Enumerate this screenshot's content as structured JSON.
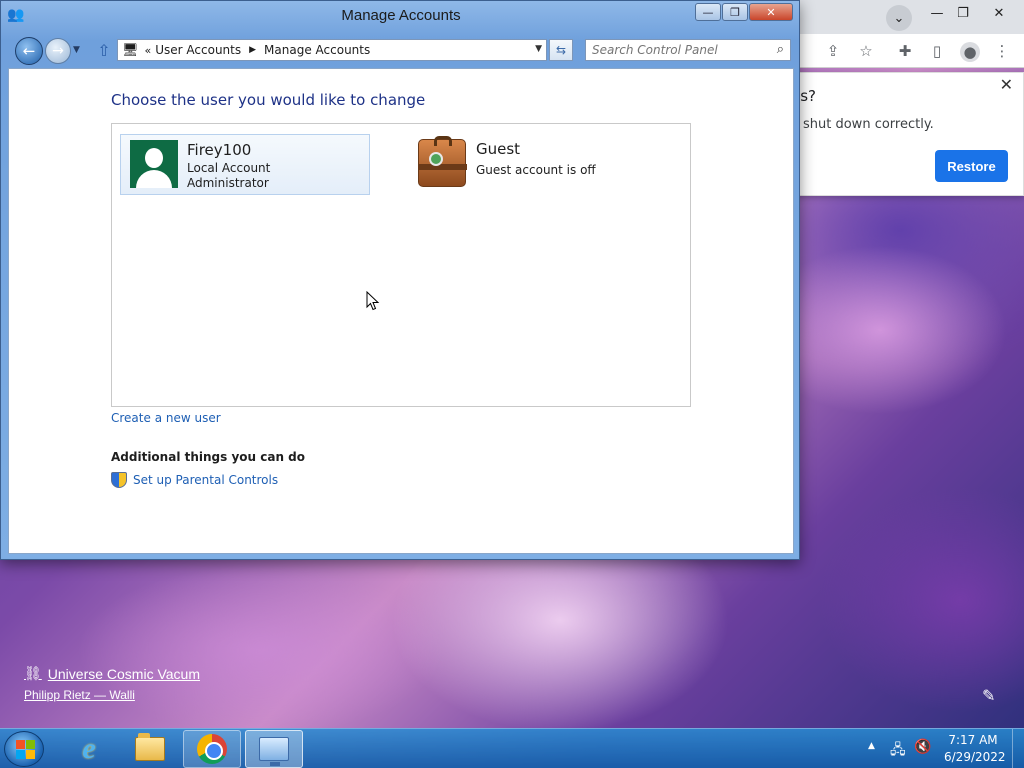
{
  "window": {
    "title": "Manage Accounts",
    "minimize": "—",
    "maximize": "❐",
    "close": "✕"
  },
  "nav": {
    "back": "←",
    "forward": "→",
    "up": "⇧",
    "breadcrumb": [
      "User Accounts",
      "Manage Accounts"
    ],
    "search_placeholder": "Search Control Panel"
  },
  "main": {
    "heading": "Choose the user you would like to change",
    "users": [
      {
        "name": "Firey100",
        "line1": "Local Account",
        "line2": "Administrator"
      },
      {
        "name": "Guest",
        "line1": "Guest account is off"
      }
    ],
    "create_link": "Create a new user",
    "additional_heading": "Additional things you can do",
    "parental_link": "Set up Parental Controls"
  },
  "chrome_popup": {
    "title_fragment": "es?",
    "text_fragment": "shut down correctly.",
    "restore_label": "Restore",
    "close": "✕"
  },
  "wallpaper": {
    "credit_title": "Universe Cosmic Vacum",
    "credit_author": "Philipp Rietz — Walli"
  },
  "taskbar": {
    "time": "7:17 AM",
    "date": "6/29/2022"
  },
  "colors": {
    "link": "#1e5fb4",
    "heading": "#1e3287",
    "restore_button": "#1a73e8"
  }
}
